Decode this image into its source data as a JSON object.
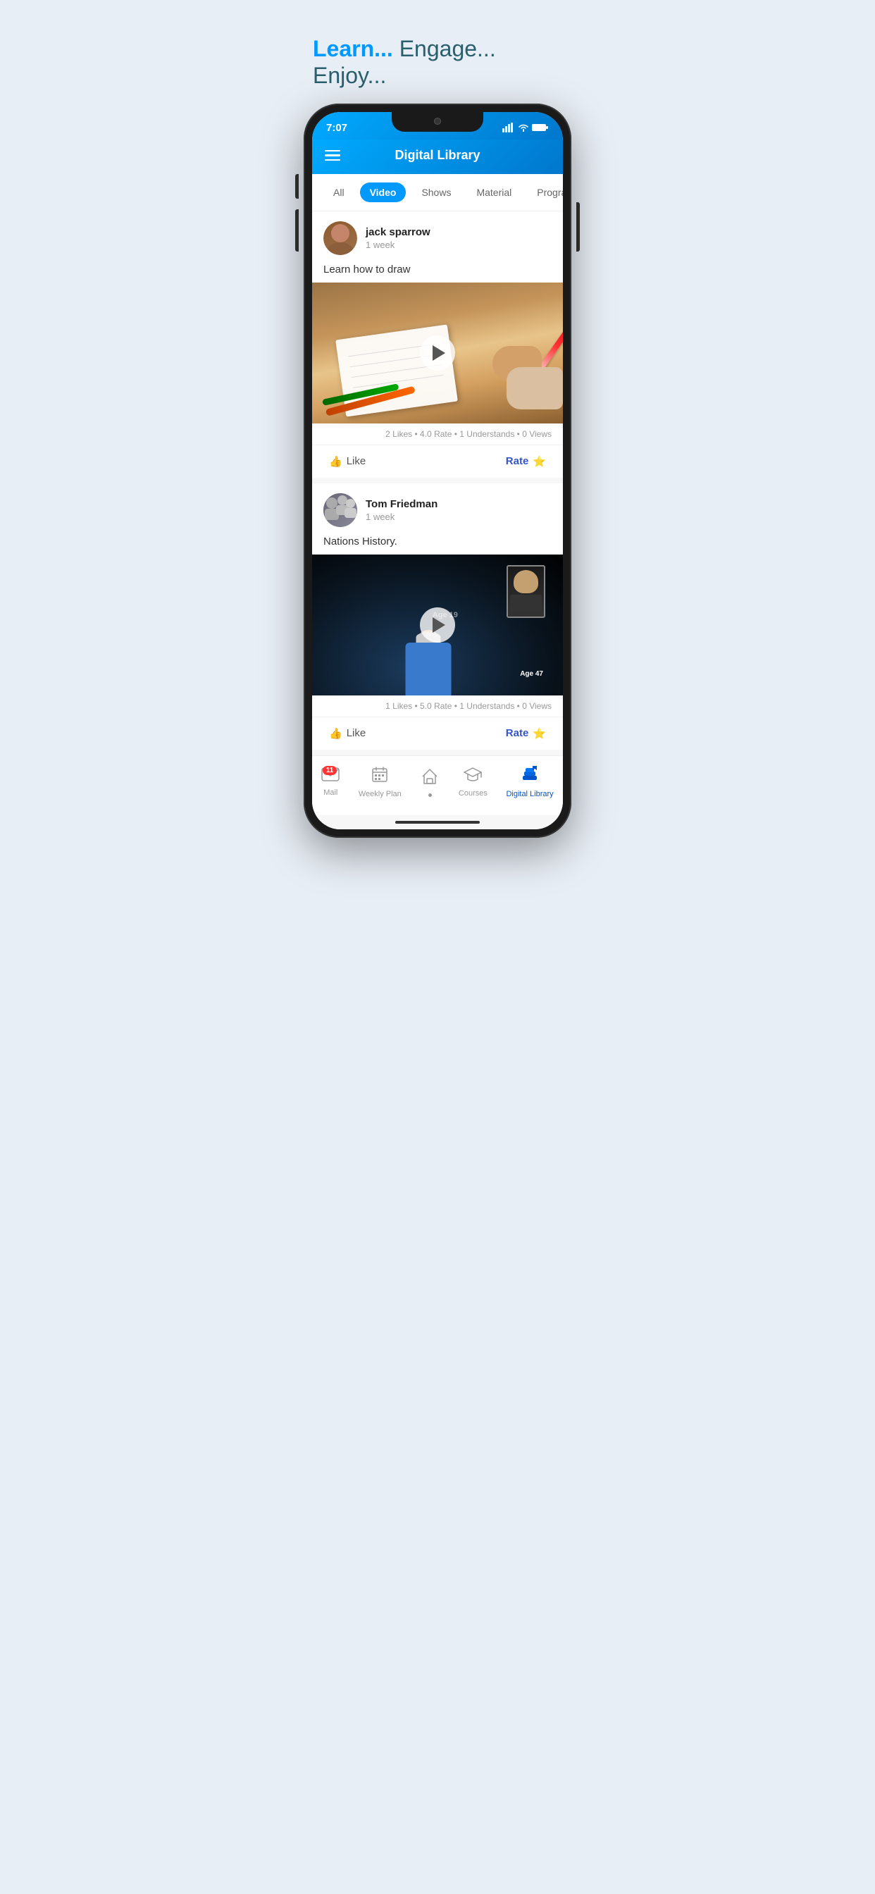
{
  "app": {
    "tagline_learn": "Learn...",
    "tagline_rest": " Engage... Enjoy...",
    "title": "Digital Library"
  },
  "status_bar": {
    "time": "7:07"
  },
  "filter_tabs": [
    {
      "id": "all",
      "label": "All",
      "active": false
    },
    {
      "id": "video",
      "label": "Video",
      "active": true
    },
    {
      "id": "shows",
      "label": "Shows",
      "active": false
    },
    {
      "id": "material",
      "label": "Material",
      "active": false
    },
    {
      "id": "programs",
      "label": "Programs",
      "active": false
    }
  ],
  "posts": [
    {
      "id": "post1",
      "author": "jack sparrow",
      "time": "1 week",
      "description": "Learn how to draw",
      "stats": "2 Likes  •  4.0 Rate  •  1 Understands  •  0 Views",
      "like_label": "Like",
      "rate_label": "Rate"
    },
    {
      "id": "post2",
      "author": "Tom Friedman",
      "time": "1 week",
      "description": "Nations History.",
      "stats": "1 Likes  •  5.0 Rate  •  1 Understands  •  0 Views",
      "like_label": "Like",
      "rate_label": "Rate"
    }
  ],
  "bottom_nav": [
    {
      "id": "mail",
      "label": "Mail",
      "badge": "11",
      "active": false
    },
    {
      "id": "weekly-plan",
      "label": "Weekly Plan",
      "badge": null,
      "active": false
    },
    {
      "id": "home",
      "label": "",
      "badge": null,
      "active": false
    },
    {
      "id": "courses",
      "label": "Courses",
      "badge": null,
      "active": false
    },
    {
      "id": "digital-library",
      "label": "Digital Library",
      "badge": null,
      "active": true
    }
  ]
}
